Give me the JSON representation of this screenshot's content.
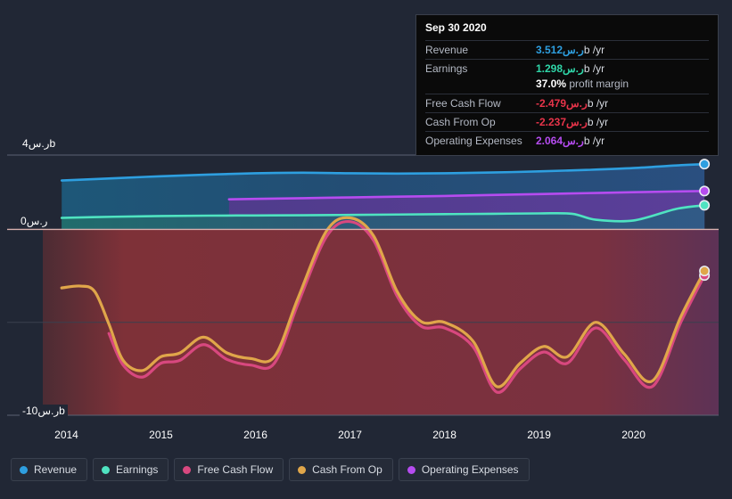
{
  "chart_data": {
    "type": "area",
    "title": "",
    "xlabel": "",
    "ylabel": "",
    "currency": "ر.س",
    "unit": "b",
    "grid": true,
    "legend_position": "bottom",
    "xlim": [
      2013.75,
      2020.9
    ],
    "ylim": [
      -10,
      4
    ],
    "x_ticks": [
      "2014",
      "2015",
      "2016",
      "2017",
      "2018",
      "2019",
      "2020"
    ],
    "x_tick_values": [
      2014,
      2015,
      2016,
      2017,
      2018,
      2019,
      2020
    ],
    "y_ticks": [
      "ر.س4b",
      "ر.س0",
      "-ر.س10b"
    ],
    "y_tick_values": [
      4,
      0,
      -10
    ],
    "series": [
      {
        "name": "Revenue",
        "color": "#2e9fe0",
        "x": [
          2013.95,
          2014.5,
          2015.0,
          2015.5,
          2016.0,
          2016.5,
          2017.0,
          2017.5,
          2018.0,
          2018.5,
          2019.0,
          2019.5,
          2020.0,
          2020.45,
          2020.75
        ],
        "values": [
          2.63,
          2.75,
          2.86,
          2.95,
          3.02,
          3.05,
          3.02,
          3.0,
          3.02,
          3.06,
          3.12,
          3.2,
          3.3,
          3.44,
          3.512
        ]
      },
      {
        "name": "Earnings",
        "color": "#4fe3c1",
        "x": [
          2013.95,
          2014.5,
          2015.0,
          2015.5,
          2016.0,
          2016.5,
          2017.0,
          2017.5,
          2018.0,
          2018.5,
          2019.0,
          2019.35,
          2019.6,
          2020.0,
          2020.45,
          2020.75
        ],
        "values": [
          0.62,
          0.68,
          0.72,
          0.74,
          0.75,
          0.76,
          0.78,
          0.8,
          0.82,
          0.84,
          0.86,
          0.84,
          0.52,
          0.48,
          1.1,
          1.298
        ]
      },
      {
        "name": "Free Cash Flow",
        "color": "#d8487f",
        "x": [
          2014.45,
          2014.6,
          2014.8,
          2015.0,
          2015.2,
          2015.45,
          2015.7,
          2015.95,
          2016.2,
          2016.45,
          2016.75,
          2017.0,
          2017.25,
          2017.5,
          2017.75,
          2018.0,
          2018.3,
          2018.55,
          2018.8,
          2019.05,
          2019.3,
          2019.6,
          2019.9,
          2020.2,
          2020.5,
          2020.75
        ],
        "values": [
          -5.6,
          -7.3,
          -7.95,
          -7.2,
          -7.05,
          -6.2,
          -7.0,
          -7.3,
          -7.2,
          -4.0,
          -0.4,
          0.42,
          -0.6,
          -3.6,
          -5.2,
          -5.3,
          -6.3,
          -8.75,
          -7.5,
          -6.6,
          -7.2,
          -5.3,
          -7.0,
          -8.45,
          -5.0,
          -2.479
        ]
      },
      {
        "name": "Cash From Op",
        "color": "#e0a64a",
        "x": [
          2013.95,
          2014.15,
          2014.3,
          2014.45,
          2014.6,
          2014.8,
          2015.0,
          2015.2,
          2015.45,
          2015.7,
          2015.95,
          2016.2,
          2016.45,
          2016.75,
          2017.0,
          2017.25,
          2017.5,
          2017.75,
          2018.0,
          2018.3,
          2018.55,
          2018.8,
          2019.05,
          2019.3,
          2019.6,
          2019.9,
          2020.2,
          2020.5,
          2020.75
        ],
        "values": [
          -3.15,
          -3.05,
          -3.35,
          -5.1,
          -7.05,
          -7.6,
          -6.85,
          -6.65,
          -5.8,
          -6.65,
          -6.95,
          -6.85,
          -3.7,
          -0.1,
          0.62,
          -0.35,
          -3.35,
          -4.95,
          -5.0,
          -6.0,
          -8.45,
          -7.2,
          -6.3,
          -6.85,
          -5.0,
          -6.7,
          -8.15,
          -4.7,
          -2.237
        ]
      },
      {
        "name": "Operating Expenses",
        "color": "#b64cf0",
        "x": [
          2015.72,
          2016.0,
          2016.5,
          2017.0,
          2017.5,
          2018.0,
          2018.5,
          2019.0,
          2019.5,
          2020.0,
          2020.45,
          2020.75
        ],
        "values": [
          1.62,
          1.64,
          1.68,
          1.72,
          1.76,
          1.8,
          1.85,
          1.9,
          1.95,
          2.0,
          2.04,
          2.064
        ]
      }
    ]
  },
  "tooltip": {
    "date": "Sep 30 2020",
    "rows": [
      {
        "label": "Revenue",
        "value": "3.512ر.س",
        "unit": "b /yr",
        "color": "#2e9fe0"
      },
      {
        "label": "Earnings",
        "value": "1.298ر.س",
        "unit": "b /yr",
        "color": "#2fd6a8"
      },
      {
        "label": "Free Cash Flow",
        "value": "-2.479ر.س",
        "unit": "b /yr",
        "color": "#e8344a"
      },
      {
        "label": "Cash From Op",
        "value": "-2.237ر.س",
        "unit": "b /yr",
        "color": "#e8344a"
      },
      {
        "label": "Operating Expenses",
        "value": "2.064ر.س",
        "unit": "b /yr",
        "color": "#b64cf0"
      }
    ],
    "margin_value": "37.0%",
    "margin_label": "profit margin"
  },
  "legend": {
    "items": [
      {
        "label": "Revenue",
        "color": "#2e9fe0"
      },
      {
        "label": "Earnings",
        "color": "#4fe3c1"
      },
      {
        "label": "Free Cash Flow",
        "color": "#d8487f"
      },
      {
        "label": "Cash From Op",
        "color": "#e0a64a"
      },
      {
        "label": "Operating Expenses",
        "color": "#b64cf0"
      }
    ]
  },
  "axis": {
    "y_top": "ر.س4b",
    "y_zero": "ر.س0",
    "y_bottom": "-ر.س10b"
  }
}
